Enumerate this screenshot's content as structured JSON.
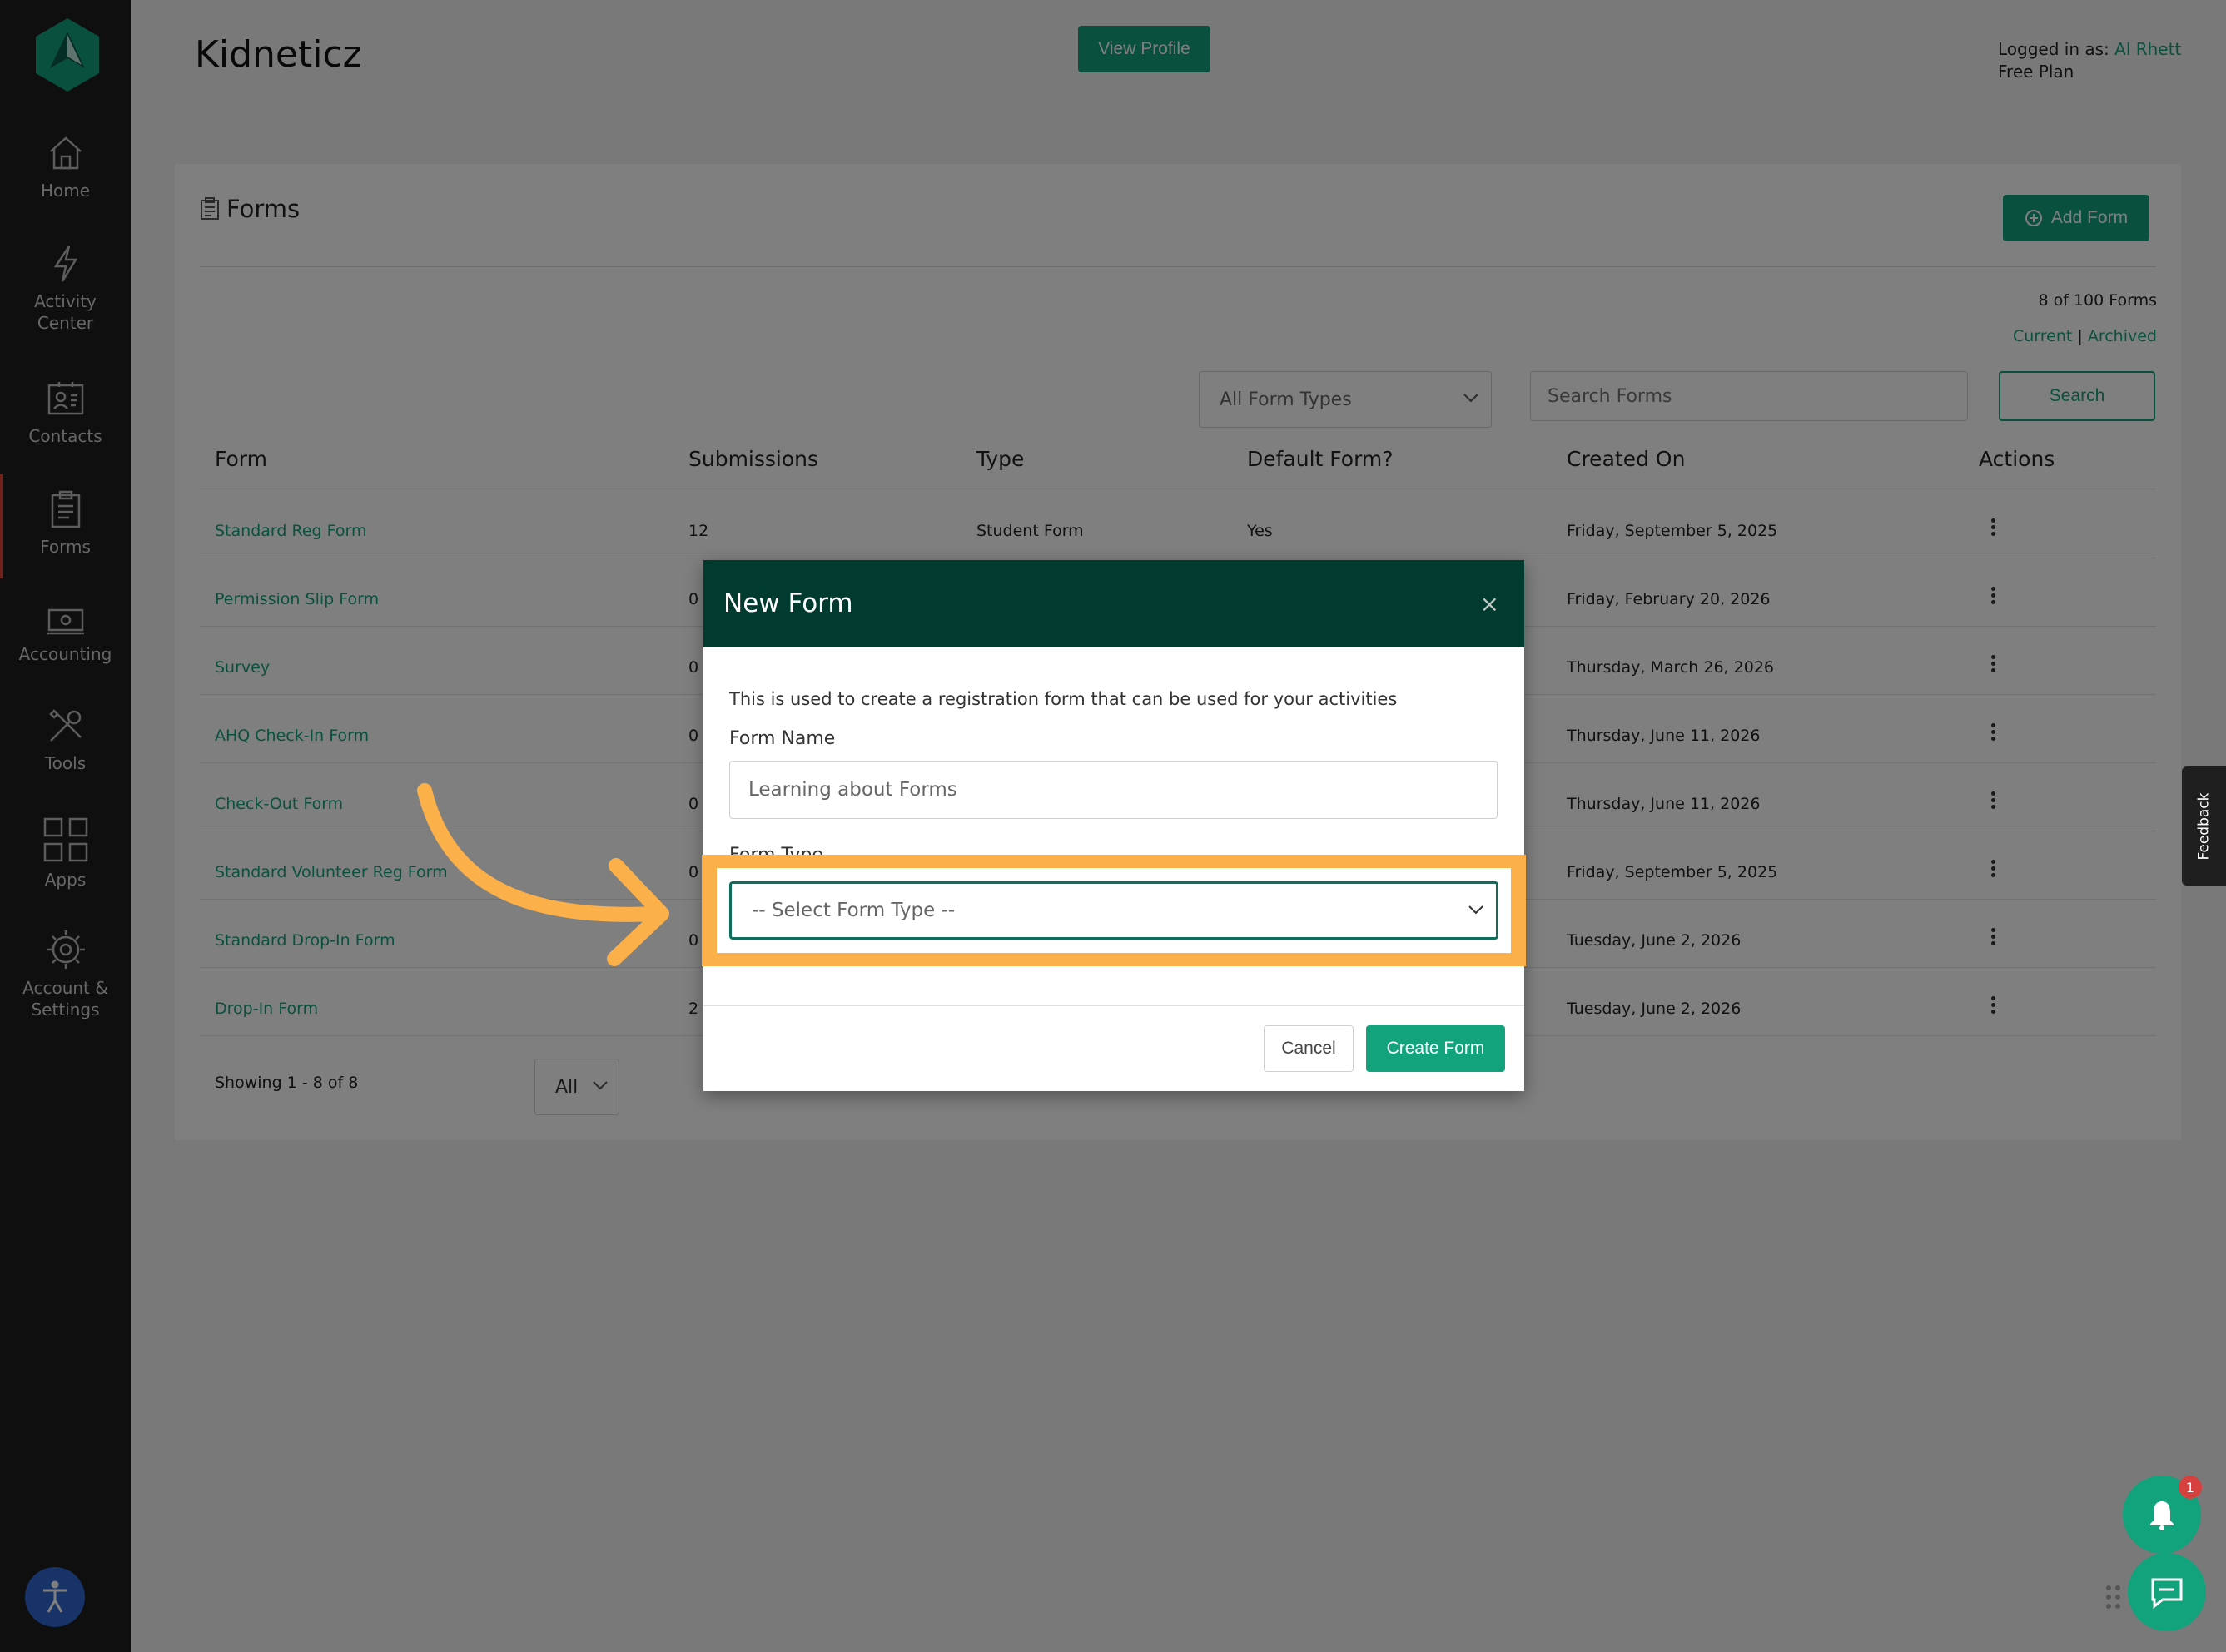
{
  "app": {
    "title": "Kidneticz"
  },
  "header": {
    "view_profile": "View Profile",
    "logged_in_label": "Logged in as:",
    "user_name": "Al Rhett",
    "plan": "Free Plan"
  },
  "sidebar": {
    "items": [
      {
        "label": "Home",
        "icon": "home-icon"
      },
      {
        "label": "Activity Center",
        "icon": "lightning-icon"
      },
      {
        "label": "Contacts",
        "icon": "contacts-icon"
      },
      {
        "label": "Forms",
        "icon": "clipboard-icon",
        "active": true
      },
      {
        "label": "Accounting",
        "icon": "money-icon"
      },
      {
        "label": "Tools",
        "icon": "tools-icon"
      },
      {
        "label": "Apps",
        "icon": "apps-grid-icon"
      },
      {
        "label": "Account & Settings",
        "icon": "gear-icon"
      }
    ]
  },
  "forms": {
    "title": "Forms",
    "add_button": "Add Form",
    "count": "8 of 100 Forms",
    "current": "Current",
    "separator": "|",
    "archived": "Archived",
    "type_filter": "All Form Types",
    "search_placeholder": "Search Forms",
    "search_button": "Search",
    "columns": [
      "Form",
      "Submissions",
      "Type",
      "Default Form?",
      "Created On",
      "Actions"
    ],
    "rows": [
      {
        "name": "Standard Reg Form",
        "submissions": "12",
        "type": "Student Form",
        "default": "Yes",
        "created": "Friday, September 5, 2025"
      },
      {
        "name": "Permission Slip Form",
        "submissions": "0",
        "type": "",
        "default": "",
        "created": "Friday, February 20, 2026"
      },
      {
        "name": "Survey",
        "submissions": "0",
        "type": "",
        "default": "",
        "created": "Thursday, March 26, 2026"
      },
      {
        "name": "AHQ Check-In Form",
        "submissions": "0",
        "type": "",
        "default": "",
        "created": "Thursday, June 11, 2026"
      },
      {
        "name": "Check-Out Form",
        "submissions": "0",
        "type": "",
        "default": "",
        "created": "Thursday, June 11, 2026"
      },
      {
        "name": "Standard Volunteer Reg Form",
        "submissions": "0",
        "type": "",
        "default": "",
        "created": "Friday, September 5, 2025"
      },
      {
        "name": "Standard Drop-In Form",
        "submissions": "0",
        "type": "",
        "default": "",
        "created": "Tuesday, June 2, 2026"
      },
      {
        "name": "Drop-In Form",
        "submissions": "2",
        "type": "",
        "default": "",
        "created": "Tuesday, June 2, 2026"
      }
    ],
    "showing": "Showing 1 - 8 of 8",
    "page_size": "All"
  },
  "modal": {
    "title": "New Form",
    "close": "×",
    "description": "This is used to create a registration form that can be used for your activities",
    "name_label": "Form Name",
    "name_value": "Learning about Forms",
    "type_label": "Form Type",
    "type_placeholder": "-- Select Form Type --",
    "cancel": "Cancel",
    "create": "Create Form"
  },
  "floating": {
    "feedback": "Feedback",
    "notification_count": "1"
  },
  "colors": {
    "accent": "#12a37d",
    "modal_header": "#013a2e",
    "highlight": "#fbb04a",
    "sidebar": "#1f1f1f"
  }
}
